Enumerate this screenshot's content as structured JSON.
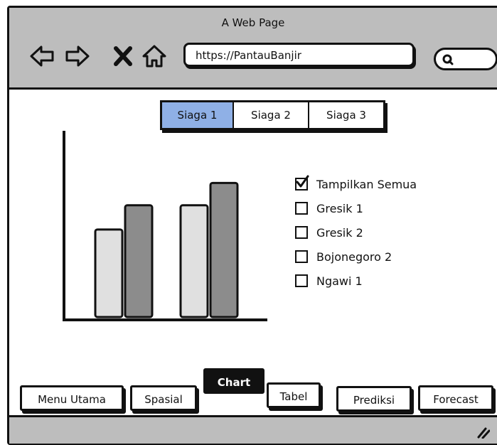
{
  "window": {
    "title": "A Web Page"
  },
  "toolbar": {
    "back_icon": "arrow-left-icon",
    "forward_icon": "arrow-right-icon",
    "stop_icon": "close-icon",
    "home_icon": "home-icon",
    "url": "https://PantauBanjir",
    "search_icon": "search-icon",
    "search_value": ""
  },
  "level_tabs": [
    {
      "label": "Siaga 1",
      "active": true
    },
    {
      "label": "Siaga 2",
      "active": false
    },
    {
      "label": "Siaga 3",
      "active": false
    }
  ],
  "chart_data": {
    "type": "bar",
    "title": "",
    "xlabel": "",
    "ylabel": "",
    "ylim": [
      0,
      100
    ],
    "categories": [
      "",
      ""
    ],
    "series": [
      {
        "values": [
          47,
          60
        ],
        "color": "#e0e0e0"
      },
      {
        "values": [
          60,
          72
        ],
        "color": "#8c8c8c"
      }
    ],
    "note_values": "unlabeled wireframe bars; heights relative to axis",
    "grid": false
  },
  "filters": [
    {
      "label": "Tampilkan Semua",
      "checked": true
    },
    {
      "label": "Gresik 1",
      "checked": false
    },
    {
      "label": "Gresik 2",
      "checked": false
    },
    {
      "label": "Bojonegoro 2",
      "checked": false
    },
    {
      "label": "Ngawi 1",
      "checked": false
    }
  ],
  "bottom_nav": [
    {
      "label": "Menu Utama",
      "active": false
    },
    {
      "label": "Spasial",
      "active": false
    },
    {
      "label": "Chart",
      "active": true
    },
    {
      "label": "Tabel",
      "active": false
    },
    {
      "label": "Prediksi",
      "active": false
    },
    {
      "label": "Forecast",
      "active": false
    }
  ],
  "statusbar": {
    "resize_icon": "resize-grip-icon"
  },
  "colors": {
    "chrome": "#bdbdbd",
    "accent": "#8fb0e6",
    "bar_light": "#e0e0e0",
    "bar_dark": "#8c8c8c",
    "active_tab": "#111111"
  }
}
